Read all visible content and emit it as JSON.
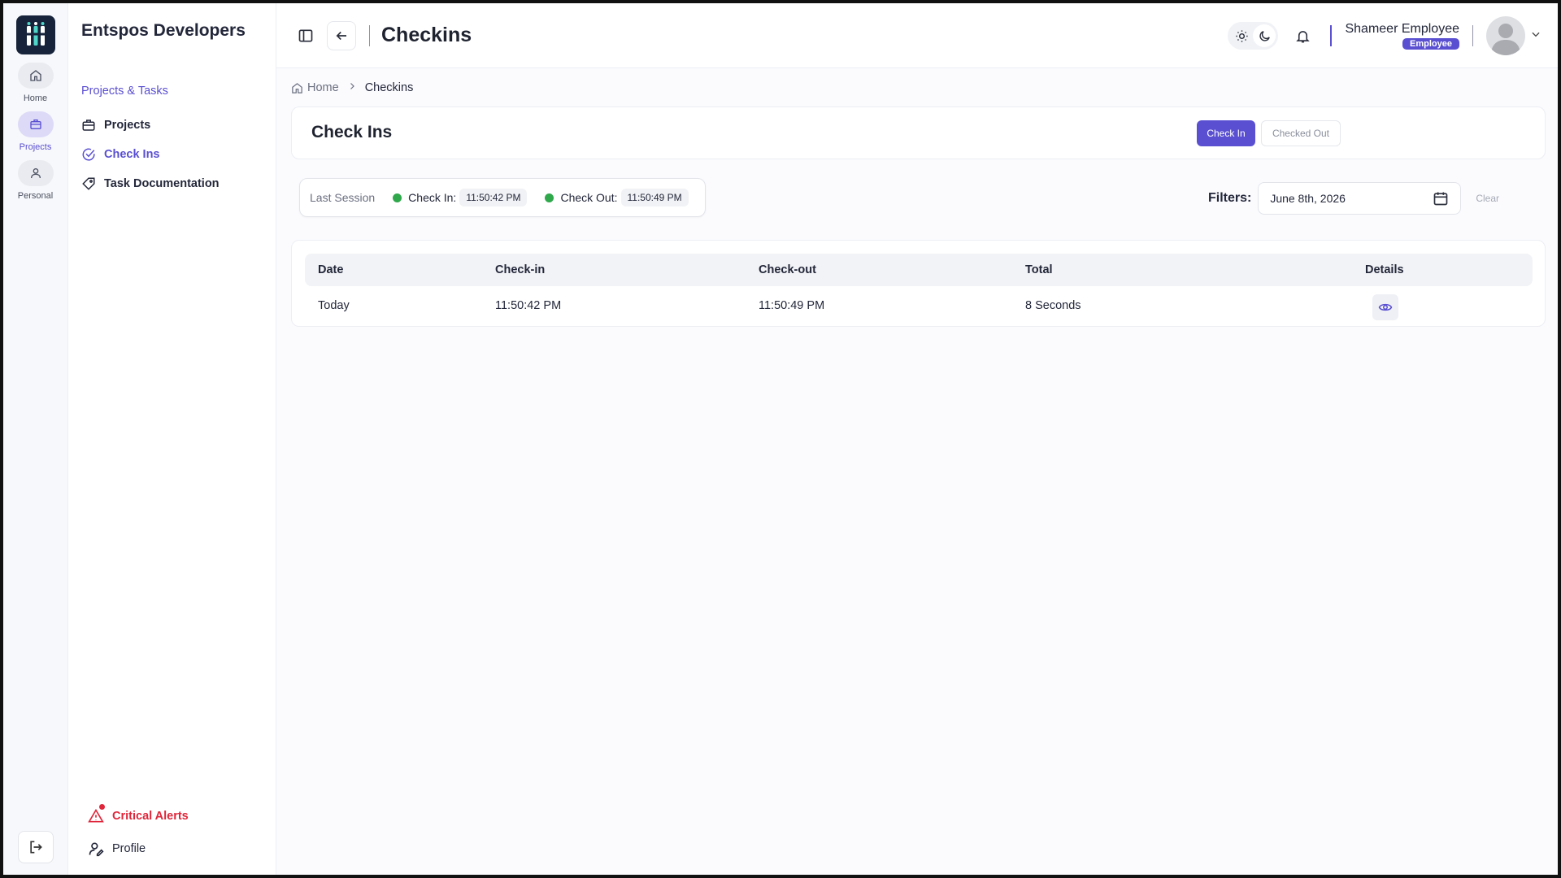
{
  "rail": {
    "items": [
      {
        "label": "Home",
        "icon": "home-icon"
      },
      {
        "label": "Projects",
        "icon": "briefcase-icon"
      },
      {
        "label": "Personal",
        "icon": "user-icon"
      }
    ],
    "logout_icon": "logout-icon"
  },
  "sidebar": {
    "org_name": "Entspos Developers",
    "section_title": "Projects & Tasks",
    "items": [
      {
        "label": "Projects",
        "icon": "briefcase-icon"
      },
      {
        "label": "Check Ins",
        "icon": "check-circle-icon"
      },
      {
        "label": "Task Documentation",
        "icon": "tag-icon"
      }
    ],
    "bottom": {
      "alerts_label": "Critical Alerts",
      "profile_label": "Profile"
    }
  },
  "header": {
    "title": "Checkins",
    "user_name": "Shameer Employee",
    "user_role": "Employee"
  },
  "breadcrumb": {
    "home": "Home",
    "current": "Checkins"
  },
  "page": {
    "heading": "Check Ins",
    "check_in_label": "Check In",
    "checked_out_label": "Checked Out"
  },
  "session": {
    "label": "Last Session",
    "check_in_label": "Check In:",
    "check_in_time": "11:50:42 PM",
    "check_out_label": "Check Out:",
    "check_out_time": "11:50:49 PM"
  },
  "filters": {
    "label": "Filters:",
    "date_value": "June 8th, 2026",
    "clear_label": "Clear"
  },
  "table": {
    "columns": [
      "Date",
      "Check-in",
      "Check-out",
      "Total",
      "Details"
    ],
    "rows": [
      {
        "date": "Today",
        "check_in": "11:50:42 PM",
        "check_out": "11:50:49 PM",
        "total": "8 Seconds"
      }
    ]
  },
  "colors": {
    "accent": "#5a4fd1",
    "alert": "#e0263a",
    "status_dot": "#2ea84a",
    "logo_bg": "#16233a"
  }
}
